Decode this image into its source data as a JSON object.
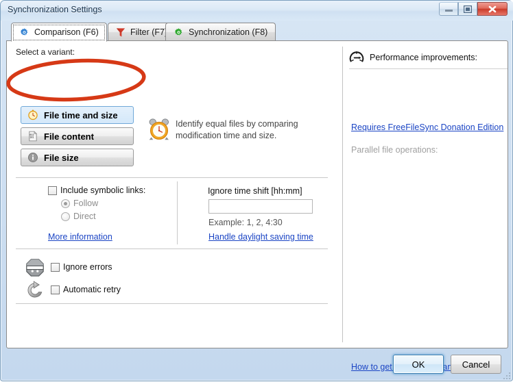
{
  "window": {
    "title": "Synchronization Settings",
    "controls": {
      "minimize": "minimize-button",
      "maximize": "maximize-button",
      "close": "close-button"
    }
  },
  "tabs": [
    {
      "label": "Comparison (F6)",
      "icon": "blue-gear-icon",
      "active": true
    },
    {
      "label": "Filter (F7)",
      "icon": "red-funnel-icon",
      "active": false
    },
    {
      "label": "Synchronization (F8)",
      "icon": "green-gear-icon",
      "active": false
    }
  ],
  "comparison": {
    "variant_label": "Select a variant:",
    "variants": [
      {
        "label": "File time and size",
        "icon": "clock-icon",
        "selected": true
      },
      {
        "label": "File content",
        "icon": "binary-document-icon",
        "selected": false
      },
      {
        "label": "File size",
        "icon": "info-circle-icon",
        "selected": false
      }
    ],
    "description": "Identify equal files by comparing modification time and size.",
    "description_icon": "alarm-clock-icon",
    "symbolic_links": {
      "checkbox_label": "Include symbolic links:",
      "checked": false,
      "options": [
        {
          "label": "Follow",
          "selected": true
        },
        {
          "label": "Direct",
          "selected": false
        }
      ],
      "more_info_link": "More information"
    },
    "time_shift": {
      "label": "Ignore time shift [hh:mm]",
      "value": "",
      "placeholder": "",
      "example": "Example: 1, 2, 4:30",
      "dst_link": "Handle daylight saving time"
    },
    "error_handling": [
      {
        "label": "Ignore errors",
        "checked": false,
        "icon": "ignore-errors-icon"
      },
      {
        "label": "Automatic retry",
        "checked": false,
        "icon": "retry-icon"
      }
    ]
  },
  "performance": {
    "title": "Performance improvements:",
    "icon": "speedometer-icon",
    "donation_link": "Requires FreeFileSync Donation Edition",
    "parallel_label": "Parallel file operations:",
    "best_performance_link": "How to get best performance?"
  },
  "footer": {
    "ok_label": "OK",
    "cancel_label": "Cancel"
  },
  "annotation": {
    "type": "ellipse-highlight",
    "color": "#d63916",
    "target": "File time and size"
  },
  "colors": {
    "accent": "#1a44c4",
    "annotation_red": "#d63916",
    "titlebar": "#d7e6f5",
    "selected_variant": "#d4e8fa"
  }
}
